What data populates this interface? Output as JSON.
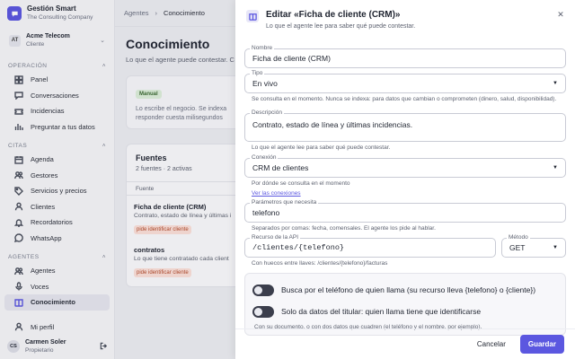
{
  "brand": {
    "logo_icon": "chat-bubble-icon",
    "name": "Gestión Smart",
    "subtitle": "The Consulting Company",
    "accent": "#5b57e0"
  },
  "org": {
    "badge": "AT",
    "name": "Acme Telecom",
    "role": "Cliente"
  },
  "sidebar": {
    "sections": [
      {
        "title": "OPERACIÓN",
        "items": [
          {
            "label": "Panel",
            "icon": "dashboard-icon"
          },
          {
            "label": "Conversaciones",
            "icon": "chat-icon"
          },
          {
            "label": "Incidencias",
            "icon": "ticket-icon"
          },
          {
            "label": "Preguntar a tus datos",
            "icon": "chart-icon"
          }
        ]
      },
      {
        "title": "CITAS",
        "items": [
          {
            "label": "Agenda",
            "icon": "calendar-icon"
          },
          {
            "label": "Gestores",
            "icon": "people-icon"
          },
          {
            "label": "Servicios y precios",
            "icon": "tag-icon"
          },
          {
            "label": "Clientes",
            "icon": "user-icon"
          },
          {
            "label": "Recordatorios",
            "icon": "bell-icon"
          },
          {
            "label": "WhatsApp",
            "icon": "whatsapp-icon"
          }
        ]
      },
      {
        "title": "AGENTES",
        "items": [
          {
            "label": "Agentes",
            "icon": "agent-icon"
          },
          {
            "label": "Voces",
            "icon": "mic-icon"
          },
          {
            "label": "Conocimiento",
            "icon": "book-icon",
            "active": true
          }
        ]
      }
    ],
    "footer_item": {
      "label": "Mi perfil",
      "icon": "profile-icon"
    }
  },
  "user": {
    "initials": "CS",
    "name": "Carmen Soler",
    "role": "Propietario"
  },
  "breadcrumb": {
    "parent": "Agentes",
    "separator": "›",
    "current": "Conocimiento"
  },
  "main": {
    "title": "Conocimiento",
    "subtitle": "Lo que el agente puede contestar. C",
    "manual": {
      "tag": "Manual",
      "text": "Lo escribe el negocio. Se indexa responder cuesta milisegundos"
    },
    "sources": {
      "title": "Fuentes",
      "count": "2 fuentes · 2 activas",
      "column": "Fuente",
      "items": [
        {
          "name": "Ficha de cliente (CRM)",
          "desc": "Contrato, estado de línea y últimas i",
          "tag": "pide identificar cliente"
        },
        {
          "name": "contratos",
          "desc": "Lo que tiene contratado cada client",
          "tag": "pide identificar cliente"
        }
      ]
    }
  },
  "drawer": {
    "icon": "book-icon",
    "title": "Editar «Ficha de cliente (CRM)»",
    "subtitle": "Lo que el agente lee para saber qué puede contestar.",
    "close": "✕",
    "fields": {
      "nombre": {
        "label": "Nombre",
        "value": "Ficha de cliente (CRM)"
      },
      "tipo": {
        "label": "Tipo",
        "value": "En vivo",
        "help": "Se consulta en el momento. Nunca se indexa: para datos que cambian o comprometen (dinero, salud, disponibilidad)."
      },
      "descripcion": {
        "label": "Descripción",
        "value": "Contrato, estado de línea y últimas incidencias.",
        "help": "Lo que el agente lee para saber qué puede contestar."
      },
      "conexion": {
        "label": "Conexión",
        "value": "CRM de clientes",
        "help": "Por dónde se consulta en el momento",
        "link": "Ver las conexiones"
      },
      "parametros": {
        "label": "Parámetros que necesita",
        "value": "telefono",
        "help": "Separados por comas: fecha, comensales. El agente los pide al hablar."
      },
      "recurso": {
        "label": "Recurso de la API",
        "value": "/clientes/{telefono}",
        "help": "Con huecos entre llaves: /clientes/{telefono}/facturas"
      },
      "metodo": {
        "label": "Método",
        "value": "GET"
      }
    },
    "toggles": [
      {
        "label": "Busca por el teléfono de quien llama (su recurso lleva {telefono} o {cliente})",
        "on": false
      },
      {
        "label": "Solo da datos del titular: quien llama tiene que identificarse",
        "on": false
      }
    ],
    "toggle_note": "Con su documento, o con dos datos que cuadren (el teléfono y el nombre, por ejemplo).",
    "cancel_label": "Cancelar",
    "save_label": "Guardar"
  }
}
